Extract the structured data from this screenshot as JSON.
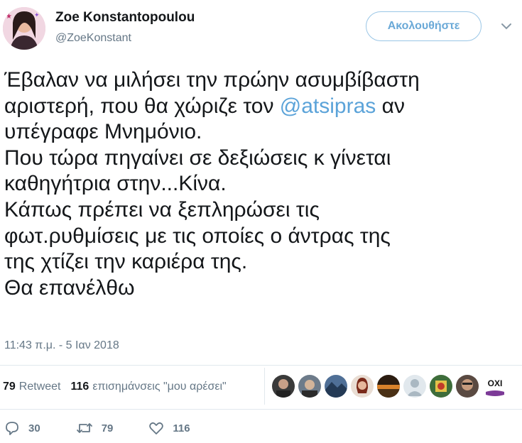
{
  "user": {
    "name": "Zoe Konstantopoulou",
    "handle": "@ZoeKonstant",
    "follow_label": "Ακολουθήστε"
  },
  "tweet": {
    "line1": "Έβαλαν να μιλήσει την πρώην ασυμβίβαστη",
    "line2_before": "αριστερή, που θα χώριζε τον ",
    "mention": "@atsipras",
    "line2_after": " αν",
    "rest": "υπέγραφε Μνημόνιο.\nΠου τώρα πηγαίνει σε δεξιώσεις κ γίνεται\nκαθηγήτρια στην...Κίνα.\nΚάπως πρέπει να ξεπληρώσει τις\nφωτ.ρυθμίσεις με τις οποίες ο άντρας της\nτης χτίζει την καριέρα της.\nΘα επανέλθω"
  },
  "timestamp": "11:43 π.μ. - 5 Ιαν 2018",
  "stats": {
    "retweets_count": "79",
    "retweets_label": "Retweet",
    "likes_count": "116",
    "likes_label": "επισημάνσεις \"μου αρέσει\""
  },
  "likers_badge": "OXI",
  "actions": {
    "replies": "30",
    "retweets": "79",
    "likes": "116"
  },
  "colors": {
    "link": "#5ba3d9",
    "muted": "#657786",
    "follow_border": "#9ac6e6"
  }
}
